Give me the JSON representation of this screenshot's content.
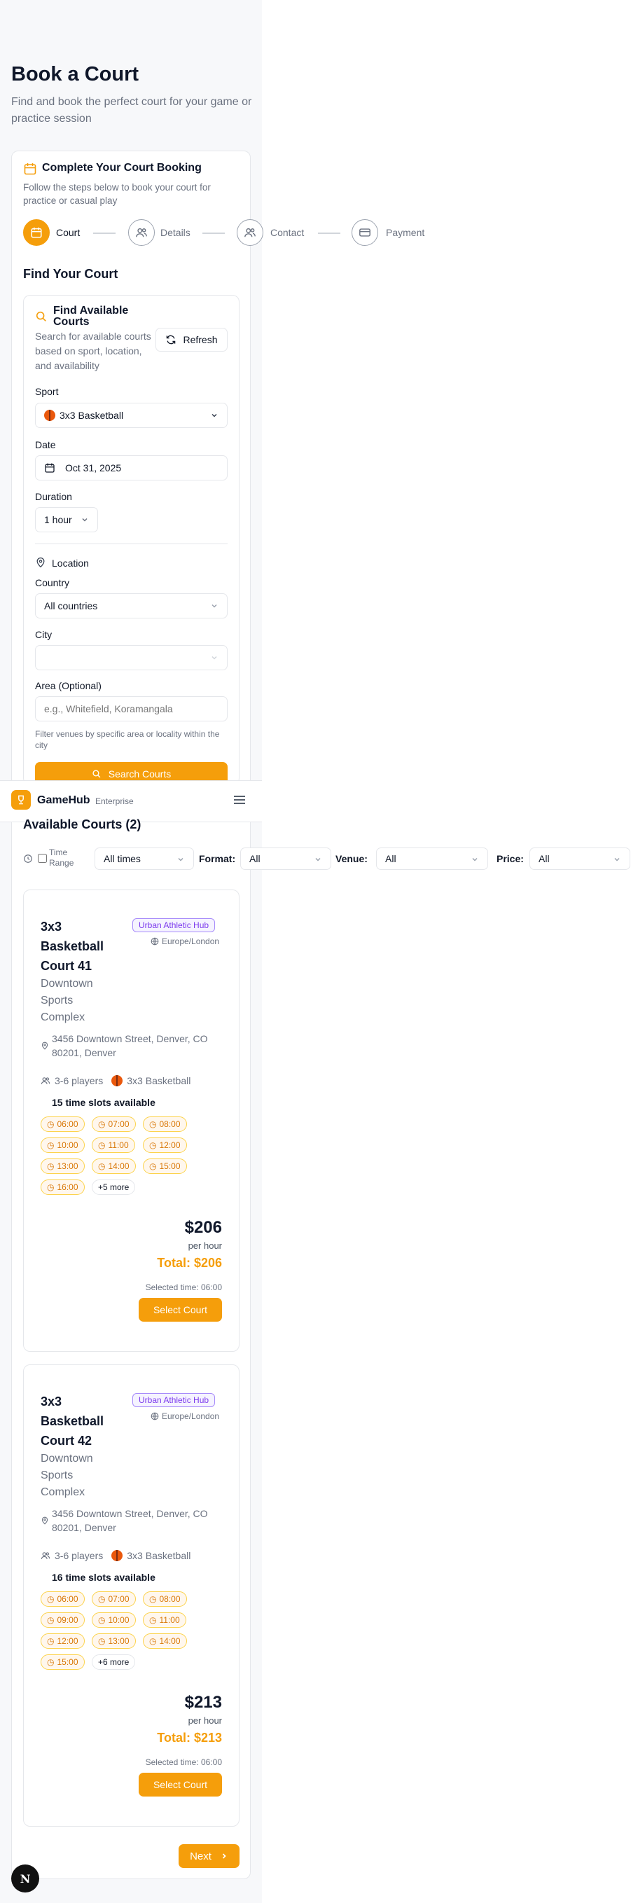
{
  "page": {
    "title": "Book a Court",
    "subtitle": "Find and book the perfect court for your game or practice session"
  },
  "booking": {
    "title": "Complete Your Court Booking",
    "description": "Follow the steps below to book your court for practice or casual play",
    "steps": [
      {
        "label": "Court",
        "icon": "calendar-icon",
        "active": true
      },
      {
        "label": "Details",
        "icon": "users-icon",
        "active": false
      },
      {
        "label": "Contact",
        "icon": "user-icon",
        "active": false
      },
      {
        "label": "Payment",
        "icon": "credit-card-icon",
        "active": false
      }
    ],
    "section_title": "Find Your Court"
  },
  "finder": {
    "title": "Find Available Courts",
    "description": "Search for available courts based on sport, location, and availability",
    "refresh_label": "Refresh",
    "sport_label": "Sport",
    "sport_value": "3x3 Basketball",
    "date_label": "Date",
    "date_value": "Oct 31, 2025",
    "duration_label": "Duration",
    "duration_value": "1 hour",
    "location_label": "Location",
    "country_label": "Country",
    "country_value": "All countries",
    "city_label": "City",
    "city_value": "",
    "area_label": "Area (Optional)",
    "area_placeholder": "e.g., Whitefield, Koramangala",
    "area_hint": "Filter venues by specific area or locality within the city",
    "search_label": "Search Courts"
  },
  "navbar": {
    "brand": "GameHub",
    "brand_sub": "Enterprise"
  },
  "results": {
    "title": "Available Courts (2)",
    "filters": {
      "time_range_label": "Time Range",
      "time_range_value": "All times",
      "format_label": "Format:",
      "format_value": "All",
      "venue_label": "Venue:",
      "venue_value": "All",
      "price_label": "Price:",
      "price_value": "All"
    },
    "courts": [
      {
        "name": "3x3 Basketball Court 41",
        "venue": "Downtown Sports Complex",
        "badge": "Urban Athletic Hub",
        "timezone": "Europe/London",
        "address": "3456 Downtown Street, Denver, CO 80201, Denver",
        "players": "3-6 players",
        "sport": "3x3 Basketball",
        "slots_title": "15 time slots available",
        "slots": [
          "06:00",
          "07:00",
          "08:00",
          "10:00",
          "11:00",
          "12:00",
          "13:00",
          "14:00",
          "15:00",
          "16:00"
        ],
        "more": "+5 more",
        "price": "$206",
        "per": "per hour",
        "total": "Total: $206",
        "selected_time": "Selected time: 06:00",
        "select_label": "Select Court"
      },
      {
        "name": "3x3 Basketball Court 42",
        "venue": "Downtown Sports Complex",
        "badge": "Urban Athletic Hub",
        "timezone": "Europe/London",
        "address": "3456 Downtown Street, Denver, CO 80201, Denver",
        "players": "3-6 players",
        "sport": "3x3 Basketball",
        "slots_title": "16 time slots available",
        "slots": [
          "06:00",
          "07:00",
          "08:00",
          "09:00",
          "10:00",
          "11:00",
          "12:00",
          "13:00",
          "14:00",
          "15:00"
        ],
        "more": "+6 more",
        "price": "$213",
        "per": "per hour",
        "total": "Total: $213",
        "selected_time": "Selected time: 06:00",
        "select_label": "Select Court"
      }
    ],
    "next_label": "Next"
  },
  "dev_badge": "N",
  "colors": {
    "accent": "#f59e0b",
    "badge_purple": "#7c3aed",
    "text_muted": "#6b7280"
  }
}
